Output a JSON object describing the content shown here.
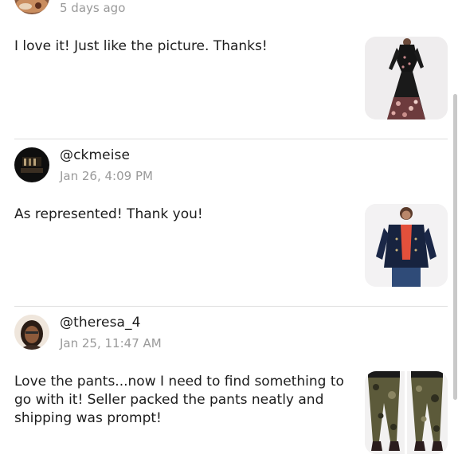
{
  "reviews": [
    {
      "handle": "",
      "time": "5 days ago",
      "text": "I love it! Just like the picture. Thanks!",
      "avatar_icon": "user-photo",
      "thumb_icon": "floral-maxi-dress"
    },
    {
      "handle": "@ckmeise",
      "time": "Jan 26, 4:09 PM",
      "text": "As represented!  Thank you!",
      "avatar_icon": "user-photo",
      "thumb_icon": "navy-jacket"
    },
    {
      "handle": "@theresa_4",
      "time": "Jan 25, 11:47 AM",
      "text": "Love the pants...now I need to find something to go with it! Seller packed the pants neatly and shipping was prompt!",
      "avatar_icon": "user-photo",
      "thumb_icon": "camo-pants"
    }
  ],
  "colors": {
    "text": "#1c1c1c",
    "muted": "#9a9a9a",
    "divider": "#dedede",
    "thumb_bg": "#f1f0f1"
  }
}
